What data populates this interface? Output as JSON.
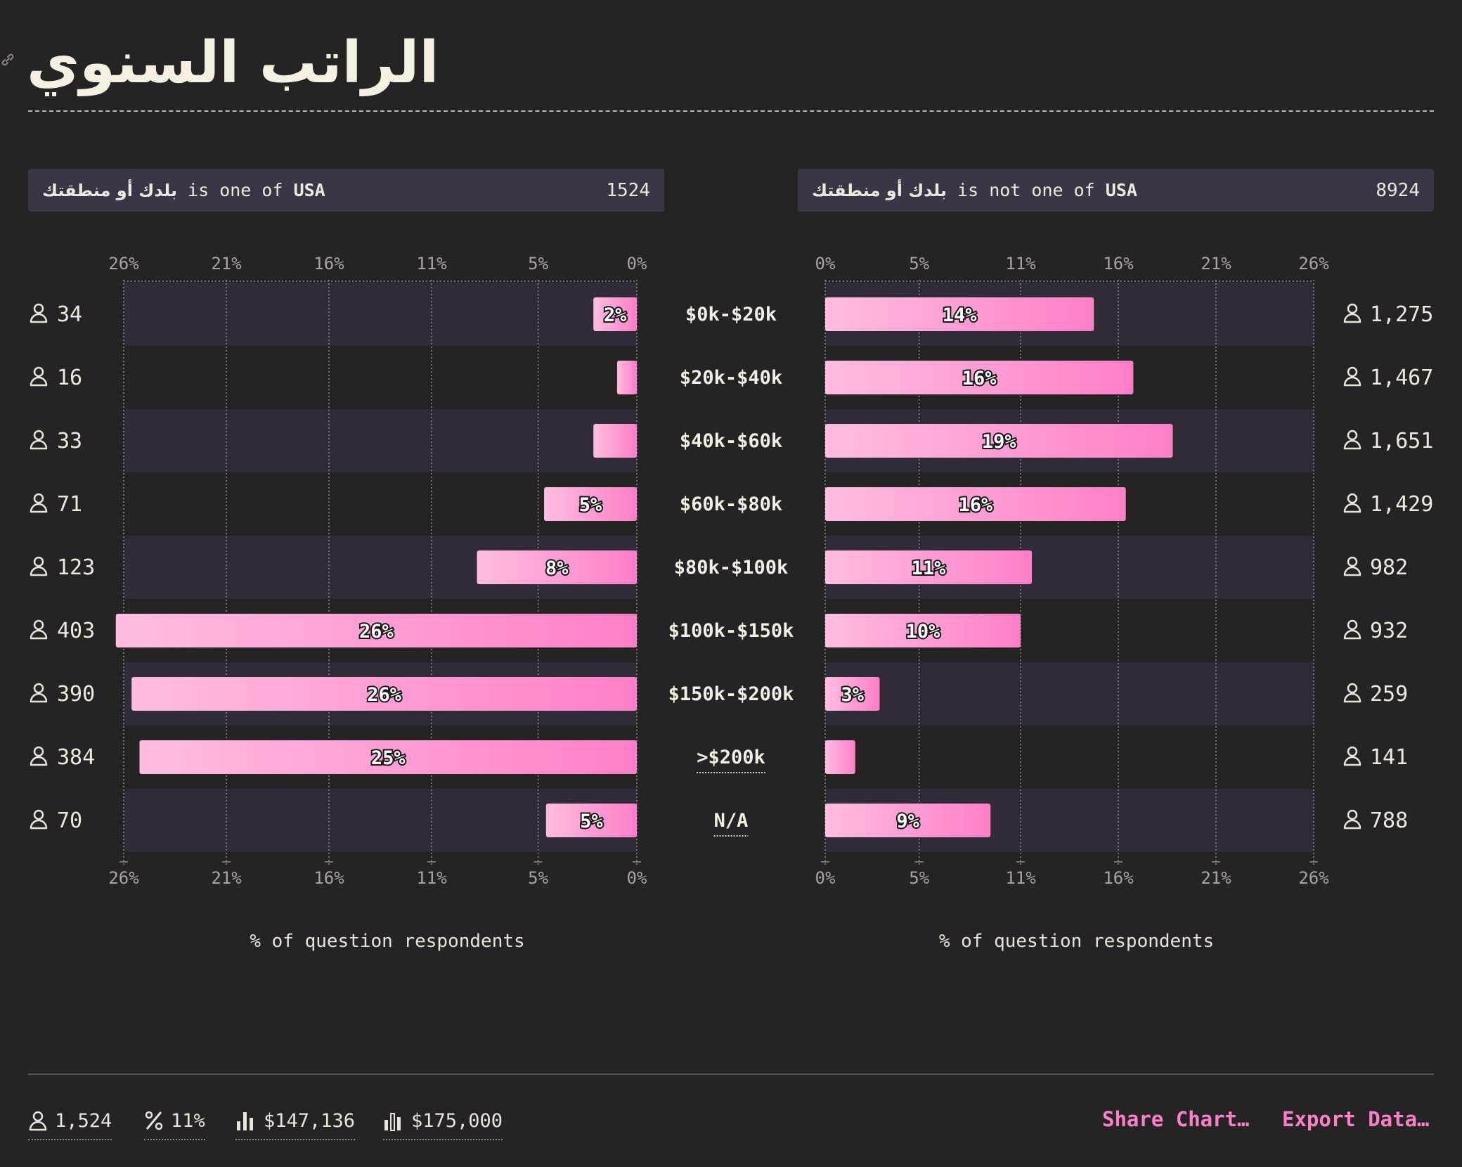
{
  "title": "الراتب السنوي",
  "colors": {
    "background": "#262325",
    "accent": "#ff80c8",
    "bar_start": "#ffbde0",
    "bar_end": "#ff7fc8",
    "band": "#302b36",
    "panel": "#3b3546"
  },
  "filters": [
    {
      "question": "بلدك أو منطقتك",
      "operator": "is one of",
      "value": "USA",
      "count": "1524"
    },
    {
      "question": "بلدك أو منطقتك",
      "operator": "is not one of",
      "value": "USA",
      "count": "8924"
    }
  ],
  "chart_data": {
    "type": "bar",
    "orientation": "horizontal",
    "layout": "back-to-back",
    "categories": [
      "$0k-$20k",
      "$20k-$40k",
      "$40k-$60k",
      "$60k-$80k",
      "$80k-$100k",
      "$100k-$150k",
      "$150k-$200k",
      ">$200k",
      "N/A"
    ],
    "underlined_categories": [
      ">$200k",
      "N/A"
    ],
    "xlim": [
      0,
      26
    ],
    "xticks": [
      "0%",
      "5%",
      "11%",
      "16%",
      "21%",
      "26%"
    ],
    "xlabel": "% of question respondents",
    "grid": true,
    "series": [
      {
        "side": "left",
        "values": [
          2.2,
          1.0,
          2.2,
          4.7,
          8.1,
          26.4,
          25.6,
          25.2,
          4.6
        ],
        "labels": [
          "2%",
          "",
          "",
          "5%",
          "8%",
          "26%",
          "26%",
          "25%",
          "5%"
        ],
        "counts": [
          "34",
          "16",
          "33",
          "71",
          "123",
          "403",
          "390",
          "384",
          "70"
        ]
      },
      {
        "side": "right",
        "values": [
          14.3,
          16.4,
          18.5,
          16.0,
          11.0,
          10.4,
          2.9,
          1.6,
          8.8
        ],
        "labels": [
          "14%",
          "16%",
          "19%",
          "16%",
          "11%",
          "10%",
          "3%",
          "",
          "9%"
        ],
        "counts": [
          "1,275",
          "1,467",
          "1,651",
          "1,429",
          "982",
          "932",
          "259",
          "141",
          "788"
        ]
      }
    ]
  },
  "footer": {
    "stats": [
      {
        "icon": "user-icon",
        "value": "1,524"
      },
      {
        "icon": "percent-icon",
        "value": "11%"
      },
      {
        "icon": "mean-bars-icon",
        "value": "$147,136"
      },
      {
        "icon": "median-bars-icon",
        "value": "$175,000"
      }
    ],
    "share_label": "Share Chart…",
    "export_label": "Export Data…"
  }
}
